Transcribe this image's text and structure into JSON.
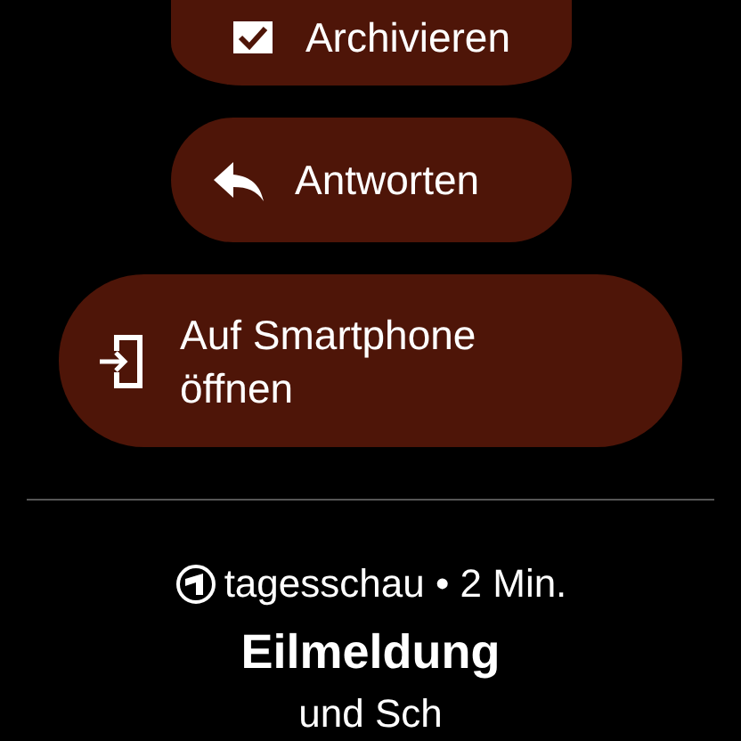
{
  "actions": [
    {
      "kind": "archive",
      "label": "Archivieren"
    },
    {
      "kind": "reply",
      "label": "Antworten"
    },
    {
      "kind": "open_phone",
      "label": "Auf Smartphone öffnen"
    }
  ],
  "notification": {
    "app": "tagesschau",
    "separator": "•",
    "time": "2 Min.",
    "title": "Eilmeldung",
    "body": "und Sch"
  }
}
